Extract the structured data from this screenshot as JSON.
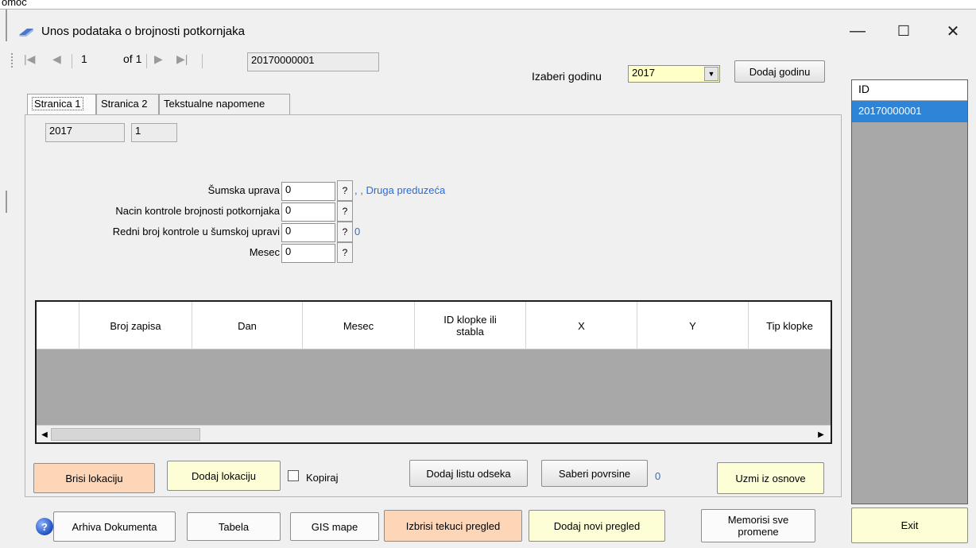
{
  "topstrip_text": "omoc",
  "window": {
    "title": "Unos podataka o brojnosti potkornjaka",
    "minimize": "—",
    "maximize": "☐",
    "close": "✕"
  },
  "navigator": {
    "first": "|◀",
    "prev": "◀",
    "position": "1",
    "of_label": "of 1",
    "next": "▶",
    "last": "▶|",
    "record_id": "20170000001"
  },
  "year_selector": {
    "label": "Izaberi godinu",
    "value": "2017",
    "dropdown": "▼",
    "add_button": "Dodaj godinu"
  },
  "tabs": [
    {
      "label": "Stranica 1"
    },
    {
      "label": "Stranica 2"
    },
    {
      "label": "Tekstualne napomene"
    }
  ],
  "page1": {
    "year_field": "2017",
    "number_field": "1",
    "fields": [
      {
        "label": "Šumska uprava",
        "value": "0",
        "button": "?",
        "extra": ", , Druga preduzeća"
      },
      {
        "label": "Nacin kontrole brojnosti potkornjaka",
        "value": "0",
        "button": "?",
        "extra": ""
      },
      {
        "label": "Redni broj kontrole u šumskoj upravi",
        "value": "0",
        "button": "?",
        "extra": "0"
      },
      {
        "label": "Mesec",
        "value": "0",
        "button": "?",
        "extra": ""
      }
    ],
    "grid_columns": [
      "Broj zapisa",
      "Dan",
      "Mesec",
      "ID klopke ili stabla",
      "X",
      "Y",
      "Tip klopke"
    ],
    "scroll_left": "◀",
    "scroll_right": "▶",
    "buttons": {
      "brisi_lokaciju": "Brisi lokaciju",
      "dodaj_lokaciju": "Dodaj lokaciju",
      "kopiraj": "Kopiraj",
      "dodaj_listu_odseka": "Dodaj listu odseka",
      "saberi_povrsine": "Saberi povrsine",
      "povrsine_value": "0",
      "uzmi_iz_osnove": "Uzmi iz osnove"
    }
  },
  "id_list": {
    "header": "ID",
    "items": [
      "20170000001"
    ]
  },
  "bottom_bar": {
    "help": "?",
    "arhiva": "Arhiva Dokumenta",
    "tabela": "Tabela",
    "gis": "GIS mape",
    "izbrisi": "Izbrisi tekuci pregled",
    "dodaj_novi": "Dodaj novi pregled",
    "memorisi": "Memorisi sve promene",
    "exit": "Exit"
  },
  "colors": {
    "selection": "#2e84d6",
    "link": "#2a6bd6",
    "peach_button": "#fdd6b8",
    "cream_button": "#fdfdd6",
    "grid_background": "#a8a8a8"
  }
}
